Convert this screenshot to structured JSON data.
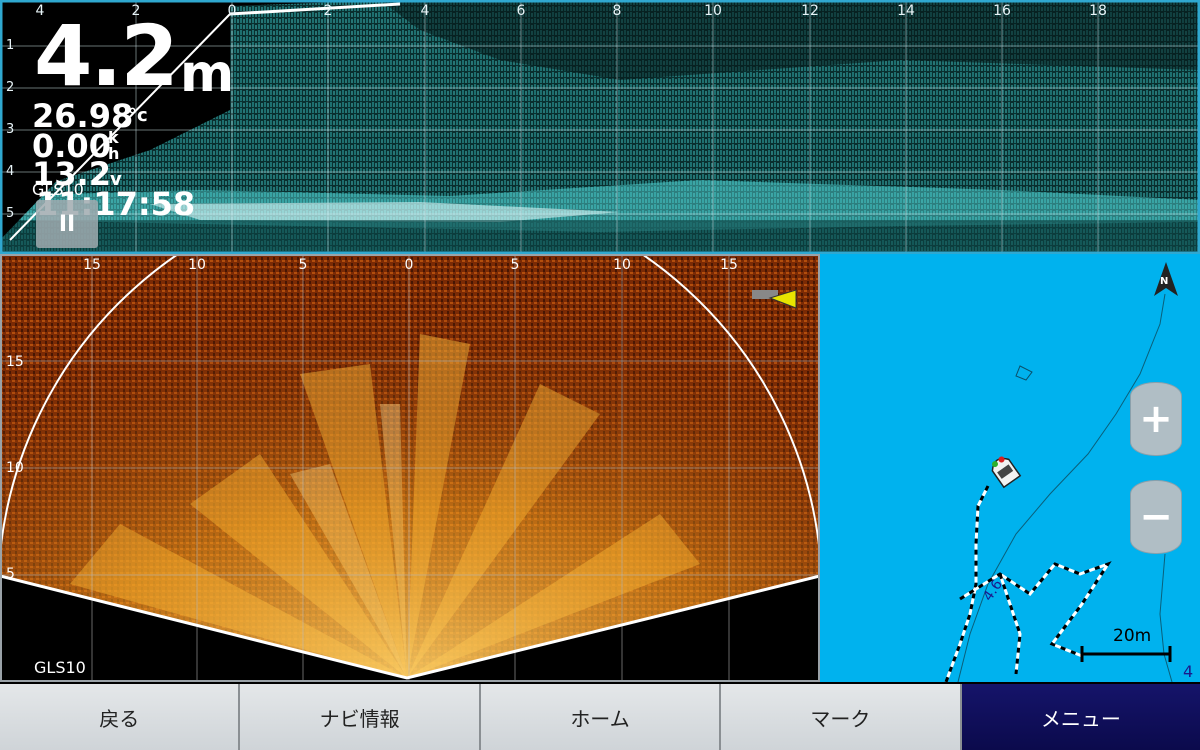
{
  "sonar_top": {
    "x_ticks": [
      "4",
      "2",
      "0",
      "2",
      "4",
      "6",
      "8",
      "10",
      "12",
      "14",
      "16",
      "18"
    ],
    "y_ticks": [
      "1",
      "2",
      "3",
      "4",
      "5"
    ],
    "depth_value": "4.2",
    "depth_unit": "m",
    "temperature": "26.98",
    "temperature_unit": "°c",
    "speed": "0.00",
    "speed_unit_top": "k",
    "speed_unit_bottom": "h",
    "voltage": "13.2",
    "voltage_unit": "v",
    "source": "GLS10",
    "time": "11:17:58",
    "pause_label": "II"
  },
  "live_sonar": {
    "x_ticks": [
      "15",
      "10",
      "5",
      "0",
      "5",
      "10",
      "15"
    ],
    "y_ticks": [
      "15",
      "10",
      "5"
    ],
    "source": "GLS10"
  },
  "map": {
    "north_label": "N",
    "zoom_in": "+",
    "zoom_out": "−",
    "scale": "20m",
    "depth_contour": "4",
    "contour_label": "4.6"
  },
  "bottom_bar": {
    "back": "戻る",
    "nav_info": "ナビ情報",
    "home": "ホーム",
    "mark": "マーク",
    "menu": "メニュー"
  },
  "colors": {
    "map_water": "#00b2ee",
    "menu_active": "#0b0a4c",
    "sonar_top_echo": "#3fd8d8",
    "sonar_live_echo": "#f0a020"
  }
}
